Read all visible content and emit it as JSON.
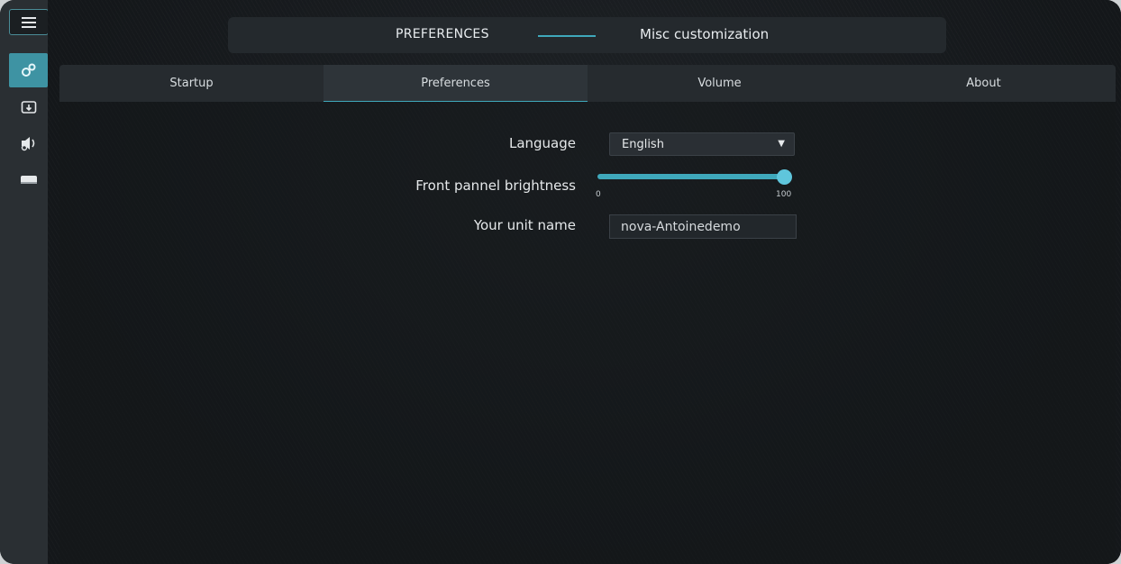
{
  "header": {
    "title": "PREFERENCES",
    "subtitle": "Misc customization"
  },
  "sidebar": {
    "items": [
      {
        "icon": "menu-icon",
        "active": false
      },
      {
        "icon": "settings-icon",
        "active": true
      },
      {
        "icon": "download-icon",
        "active": false
      },
      {
        "icon": "speaker-icon",
        "active": false
      },
      {
        "icon": "drive-icon",
        "active": false
      }
    ]
  },
  "tabs": [
    {
      "label": "Startup",
      "active": false
    },
    {
      "label": "Preferences",
      "active": true
    },
    {
      "label": "Volume",
      "active": false
    },
    {
      "label": "About",
      "active": false
    }
  ],
  "form": {
    "language": {
      "label": "Language",
      "value": "English"
    },
    "brightness": {
      "label": "Front pannel brightness",
      "min": "0",
      "max": "100",
      "value_percent": 100
    },
    "unit_name": {
      "label": "Your unit name",
      "value": "nova-Antoinedemo"
    }
  },
  "colors": {
    "accent": "#3fa8bb",
    "background": "#14171a",
    "panel": "#262b2f"
  }
}
